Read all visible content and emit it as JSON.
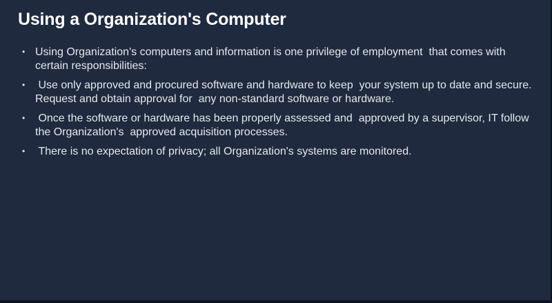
{
  "slide": {
    "title": "Using a Organization's Computer",
    "bullets": [
      {
        "text": "Using Organization's computers and information is one privilege of employment  that comes with certain responsibilities:"
      },
      {
        "text": " Use only approved and procured software and hardware to keep  your system up to date and secure. Request and obtain approval for  any non-standard software or hardware."
      },
      {
        "text": " Once the software or hardware has been properly assessed and  approved by a supervisor, IT follow the Organization's  approved acquisition processes."
      },
      {
        "text": " There is no expectation of privacy; all Organization's systems are monitored."
      }
    ],
    "bullet_glyph": "•",
    "colors": {
      "background": "#1f2a3e",
      "title": "#ffffff",
      "body_text": "#e4e8ef"
    }
  }
}
